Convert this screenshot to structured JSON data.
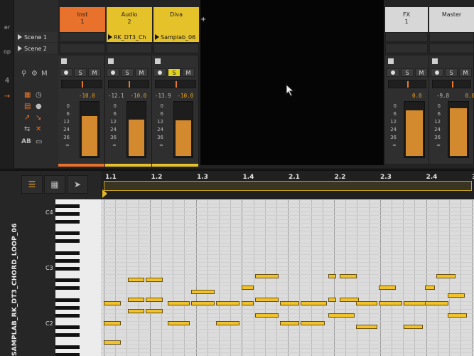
{
  "left_strip": {
    "labels": [
      "er",
      "op"
    ]
  },
  "scenes": [
    {
      "label": "Scene 1"
    },
    {
      "label": "Scene 2"
    }
  ],
  "tracks": [
    {
      "name": "Inst",
      "number": "1",
      "color": "#e8712b",
      "clip": "",
      "peak": "",
      "volume": "-10.0",
      "meter_level": 0.72,
      "solo_on": false
    },
    {
      "name": "Audio",
      "number": "2",
      "color": "#e6c22a",
      "clip": "RK_DT3_Ch",
      "peak": "-12.1",
      "volume": "-10.0",
      "meter_level": 0.66,
      "solo_on": false
    },
    {
      "name": "Diva",
      "number": "",
      "color": "#e6c22a",
      "clip": "Samplab_06",
      "peak": "-13.9",
      "volume": "-10.0",
      "meter_level": 0.64,
      "solo_on": true
    }
  ],
  "fx_track": {
    "name": "FX",
    "number": "1",
    "peak": "",
    "volume": "0.0",
    "meter_level": 0.82
  },
  "master_track": {
    "name": "Master",
    "peak": "-9.8",
    "volume": "0.0",
    "meter_level": 0.86
  },
  "meter_scale": [
    "0",
    "6",
    "12",
    "24",
    "36",
    "∞"
  ],
  "mixer_buttons": {
    "solo": "S",
    "mute": "M"
  },
  "add_track": "+",
  "editor": {
    "clip_name": "SAMPLAB_RK_DT3_CHORD_LOOP_06",
    "ruler": [
      "1.1",
      "1.2",
      "1.3",
      "1.4",
      "2.1",
      "2.2",
      "2.3",
      "2.4",
      "3"
    ],
    "key_labels": [
      "C4",
      "C3",
      "C2"
    ],
    "tools": [
      "list-icon",
      "grid-icon",
      "pointer-tool-icon"
    ]
  },
  "notes": [
    {
      "start": 0.0,
      "len": 0.4,
      "row": 26
    },
    {
      "start": 0.0,
      "len": 0.4,
      "row": 31
    },
    {
      "start": 0.0,
      "len": 0.4,
      "row": 36
    },
    {
      "start": 0.52,
      "len": 0.4,
      "row": 20
    },
    {
      "start": 0.52,
      "len": 0.4,
      "row": 25
    },
    {
      "start": 0.52,
      "len": 0.4,
      "row": 28
    },
    {
      "start": 0.92,
      "len": 0.4,
      "row": 20
    },
    {
      "start": 0.92,
      "len": 0.4,
      "row": 25
    },
    {
      "start": 0.92,
      "len": 0.4,
      "row": 28
    },
    {
      "start": 1.4,
      "len": 0.5,
      "row": 26
    },
    {
      "start": 1.4,
      "len": 0.5,
      "row": 31
    },
    {
      "start": 1.9,
      "len": 0.55,
      "row": 23
    },
    {
      "start": 1.9,
      "len": 0.55,
      "row": 26
    },
    {
      "start": 2.45,
      "len": 0.55,
      "row": 26
    },
    {
      "start": 2.45,
      "len": 0.55,
      "row": 31
    },
    {
      "start": 3.0,
      "len": 0.3,
      "row": 26
    },
    {
      "start": 3.0,
      "len": 0.3,
      "row": 22
    },
    {
      "start": 3.3,
      "len": 0.55,
      "row": 19
    },
    {
      "start": 3.3,
      "len": 0.55,
      "row": 25
    },
    {
      "start": 3.3,
      "len": 0.55,
      "row": 29
    },
    {
      "start": 3.85,
      "len": 0.45,
      "row": 26
    },
    {
      "start": 3.85,
      "len": 0.45,
      "row": 31
    },
    {
      "start": 4.3,
      "len": 0.6,
      "row": 26
    },
    {
      "start": 4.3,
      "len": 0.55,
      "row": 31
    },
    {
      "start": 4.9,
      "len": 0.2,
      "row": 19
    },
    {
      "start": 4.9,
      "len": 0.2,
      "row": 25
    },
    {
      "start": 4.9,
      "len": 0.6,
      "row": 29
    },
    {
      "start": 5.15,
      "len": 0.4,
      "row": 19
    },
    {
      "start": 5.15,
      "len": 0.45,
      "row": 25
    },
    {
      "start": 5.5,
      "len": 0.5,
      "row": 26
    },
    {
      "start": 5.5,
      "len": 0.5,
      "row": 32
    },
    {
      "start": 6.0,
      "len": 0.4,
      "row": 22
    },
    {
      "start": 6.0,
      "len": 0.55,
      "row": 26
    },
    {
      "start": 6.55,
      "len": 0.5,
      "row": 26
    },
    {
      "start": 6.55,
      "len": 0.45,
      "row": 32
    },
    {
      "start": 7.0,
      "len": 0.25,
      "row": 22
    },
    {
      "start": 7.0,
      "len": 0.55,
      "row": 26
    },
    {
      "start": 7.25,
      "len": 0.45,
      "row": 19
    },
    {
      "start": 7.5,
      "len": 0.4,
      "row": 24
    },
    {
      "start": 7.5,
      "len": 0.45,
      "row": 29
    }
  ]
}
